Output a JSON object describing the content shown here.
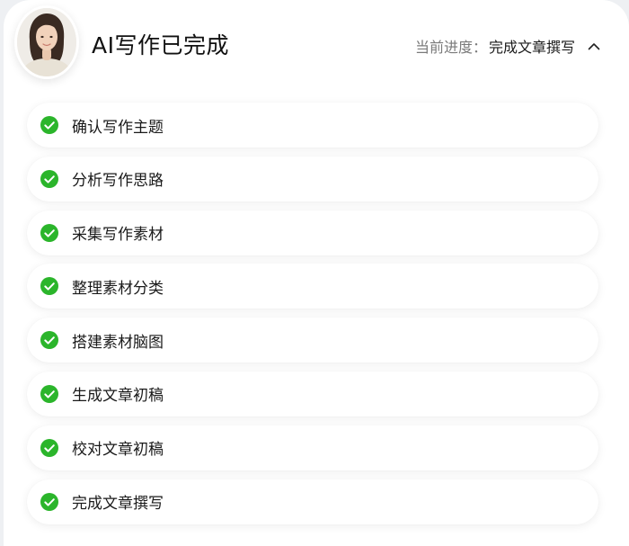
{
  "header": {
    "title": "AI写作已完成",
    "progress_label": "当前进度：",
    "progress_value": "完成文章撰写",
    "avatar_icon": "woman-portrait-avatar",
    "toggle_icon": "chevron-up-icon"
  },
  "colors": {
    "check_green": "#2bb52b",
    "title_text": "#111111",
    "muted_text": "#7a7a7a"
  },
  "steps": [
    {
      "label": "确认写作主题",
      "status": "done"
    },
    {
      "label": "分析写作思路",
      "status": "done"
    },
    {
      "label": "采集写作素材",
      "status": "done"
    },
    {
      "label": "整理素材分类",
      "status": "done"
    },
    {
      "label": "搭建素材脑图",
      "status": "done"
    },
    {
      "label": "生成文章初稿",
      "status": "done"
    },
    {
      "label": "校对文章初稿",
      "status": "done"
    },
    {
      "label": "完成文章撰写",
      "status": "done"
    }
  ]
}
